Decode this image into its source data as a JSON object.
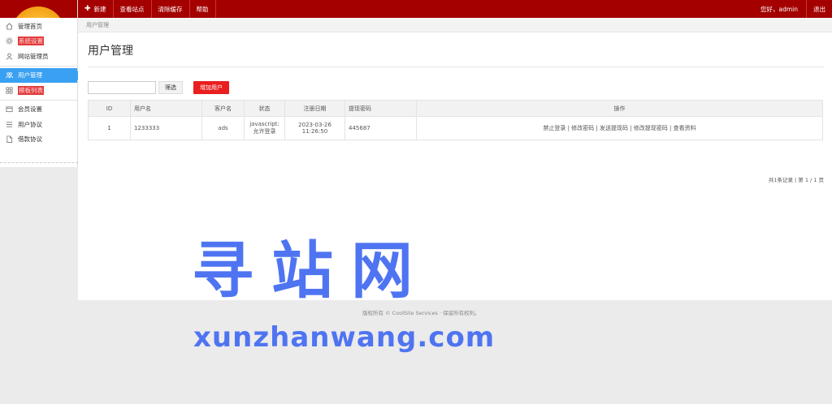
{
  "sidebar": {
    "items": [
      {
        "label": "管理首页",
        "icon": "home-icon"
      },
      {
        "label": "系统设置",
        "icon": "gear-icon",
        "highlight": true
      },
      {
        "label": "网站管理员",
        "icon": "user-icon"
      },
      {
        "label": "用户管理",
        "icon": "users-icon",
        "active": true
      },
      {
        "label": "模板列表",
        "icon": "grid-icon",
        "highlight": true
      },
      {
        "label": "会员设置",
        "icon": "card-icon"
      },
      {
        "label": "用户协议",
        "icon": "list-icon"
      },
      {
        "label": "借款协议",
        "icon": "file-icon"
      }
    ]
  },
  "topbar": {
    "buttons": [
      "新建",
      "查看站点",
      "清除缓存",
      "帮助"
    ],
    "greeting": "您好，admin",
    "logout": "退出"
  },
  "breadcrumb": "用户管理",
  "page": {
    "title": "用户管理",
    "search": {
      "value": "",
      "placeholder": ""
    },
    "filter_label": "筛选",
    "add_label": "增加用户"
  },
  "table": {
    "headers": [
      "ID",
      "用户名",
      "客户名",
      "状态",
      "注册日期",
      "提现密码",
      "操作"
    ],
    "rows": [
      {
        "id": "1",
        "username": "1233333",
        "customer": "ads",
        "status": "javascript: 允许登录",
        "date": "2023-03-26 11:26:50",
        "pin": "445687",
        "ops": "禁止登录 | 修改密码 | 发送提现码 | 修改提现密码 | 查看资料"
      }
    ]
  },
  "pager": "共1条记录 | 第 1 / 1 页",
  "copyright": "版权所有 © CoolSite Services  · 保留所有权利。",
  "watermark": {
    "cn": "寻站网",
    "en": "xunzhanwang.com"
  },
  "colors": {
    "topbar": "#a40000",
    "active": "#3aa1f2",
    "add_button": "#e91e1e",
    "watermark": "#4f74f2"
  }
}
